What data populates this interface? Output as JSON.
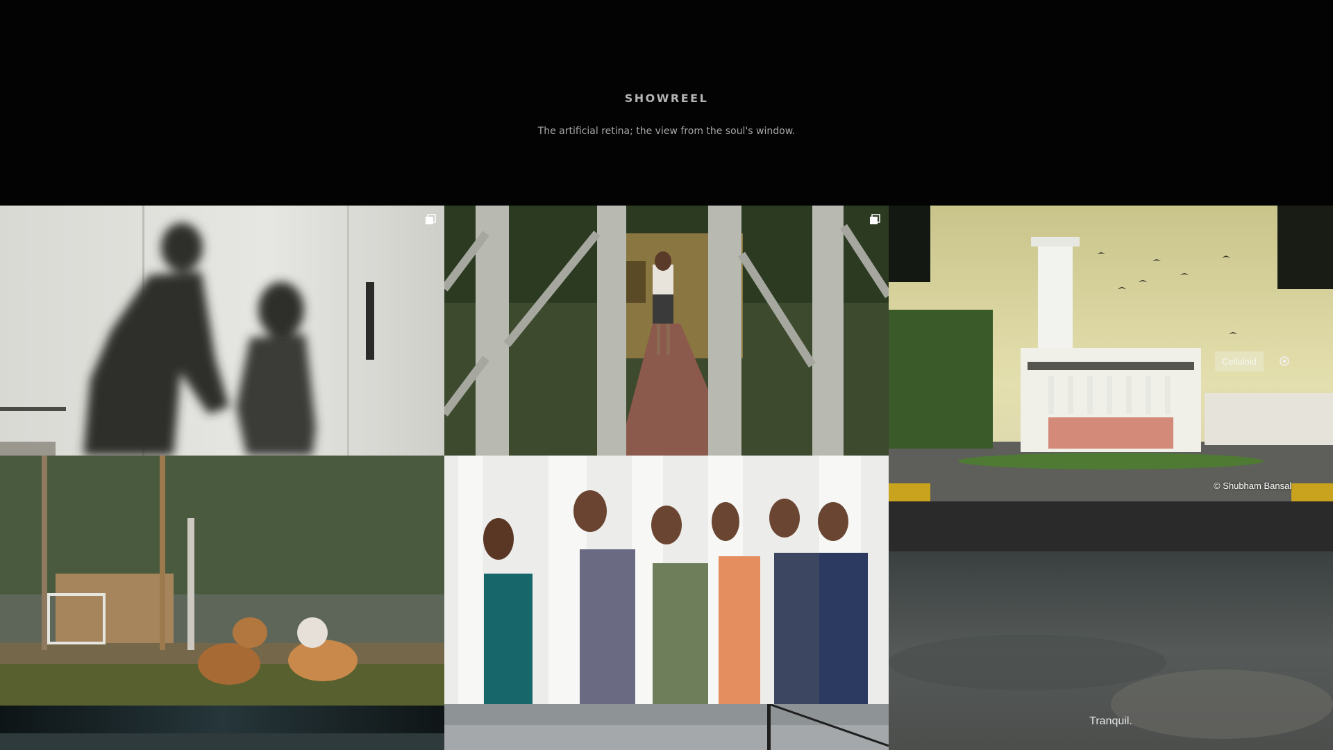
{
  "header": {
    "title": "SHOWREEL",
    "tagline": "The artificial retina; the view from the soul's window."
  },
  "tiles": {
    "silhouettes": {
      "icon": "gallery-stack-icon"
    },
    "gate": {
      "icon": "gallery-stack-icon"
    },
    "building": {
      "caption": "Celluloid",
      "icon": "target-icon",
      "credit": "© Shubham Bansal"
    },
    "sky": {
      "caption": "Tranquil."
    }
  },
  "colors": {
    "page_bg": "#030303",
    "title": "#b5b5b5",
    "tagline": "#a8a8a8"
  }
}
